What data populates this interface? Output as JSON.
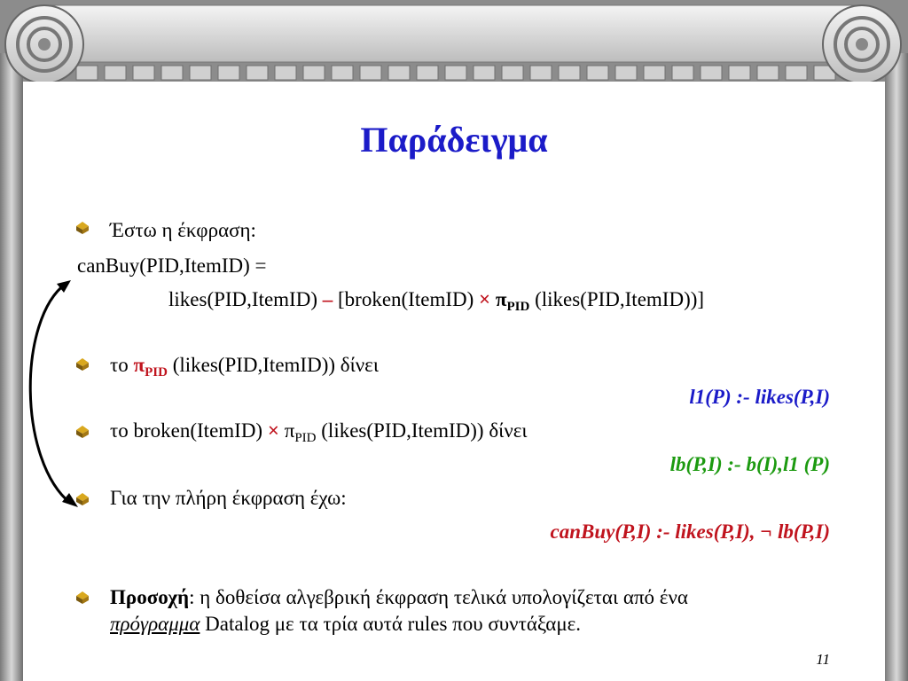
{
  "slide": {
    "title": "Παράδειγμα",
    "page_number": "11",
    "line1": "Έστω η έκφραση:",
    "line2": "canBuy(PID,ItemID) =",
    "line3": {
      "part_a": "likes(PID,ItemID) ",
      "minus": "–",
      "part_b": " [broken(ItemID) ",
      "times": "×",
      "pi": " π",
      "pi_sub": "PID",
      "part_c": " (likes(PID,ItemID))]"
    },
    "bullet2": {
      "prefix": "το ",
      "pi": "π",
      "pi_sub": "PID",
      "rest": " (likes(PID,ItemID)) δίνει"
    },
    "rule1": "l1(P) :- likes(P,I)",
    "bullet3": {
      "prefix": "το broken(ItemID) ",
      "times": "×",
      "pi": " π",
      "pi_sub": "PID",
      "rest": " (likes(PID,ItemID)) δίνει"
    },
    "rule2": "lb(P,I) :- b(I),l1 (P)",
    "bullet4": "Για την πλήρη έκφραση έχω:",
    "rule3": "canBuy(P,I) :- likes(P,I), ¬ lb(P,I)",
    "bullet5": {
      "bold": "Προσοχή",
      "rest": ": η δοθείσα αλγεβρική έκφραση τελικά υπολογίζεται από ένα",
      "underlined": "πρόγραμμα",
      "rest2": " Datalog με τα τρία αυτά rules που συντάξαμε."
    }
  },
  "colors": {
    "title": "#1b1bc8",
    "rule1": "#1b1bc8",
    "rule2": "#1c9a10",
    "rule3": "#c0141e",
    "frame": "#8c8c8c"
  }
}
